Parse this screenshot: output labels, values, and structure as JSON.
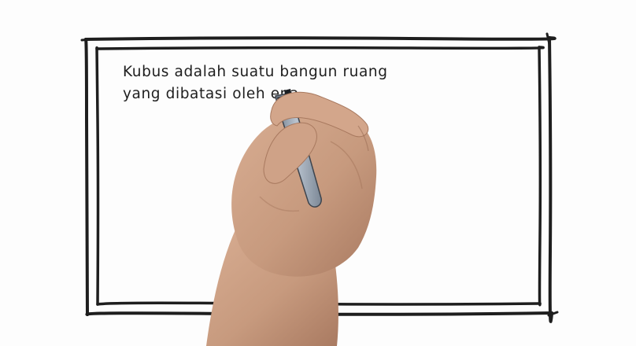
{
  "whiteboard": {
    "text_lines": [
      "Kubus adalah suatu bangun ruang",
      "yang dibatasi oleh ena"
    ]
  },
  "colors": {
    "background": "#fdfdfd",
    "ink": "#1e1e1e",
    "skin": "#c99c80",
    "marker_body": "#9aa6b4"
  },
  "illustration": {
    "icon": "hand-holding-marker-icon"
  }
}
